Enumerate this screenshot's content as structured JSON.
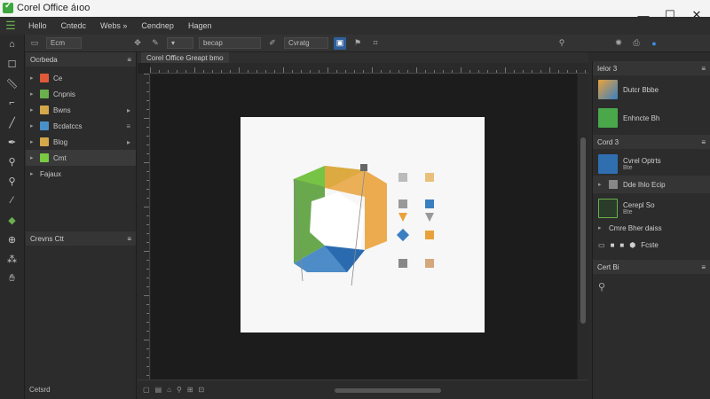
{
  "window": {
    "title": "Corel Office áıoo",
    "minimize_icon": "minimize-icon",
    "maximize_icon": "maximize-icon",
    "close_icon": "close-icon"
  },
  "menubar": {
    "items": [
      "Hello",
      "Cntedc",
      "Webs »",
      "Cendnep",
      "Hagen"
    ]
  },
  "toolbar": {
    "field1": "Ecm",
    "field2": "becap",
    "field3": "Cvratg"
  },
  "layers_panel": {
    "title": "Ocrbeda",
    "items": [
      {
        "label": "Ce",
        "color": "#e05a3a"
      },
      {
        "label": "Cnpnis",
        "color": "#6ab04c"
      },
      {
        "label": "Bwns",
        "color": "#d4a84a"
      },
      {
        "label": "Bcdatccs",
        "color": "#4a90c8"
      },
      {
        "label": "Blog",
        "color": "#d4a84a"
      },
      {
        "label": "Cmt",
        "color": "#7ac943"
      },
      {
        "label": "Fajaux",
        "color": "#888888"
      }
    ]
  },
  "lower_left_panel": {
    "title": "Crevns Ctt",
    "footer": "Cetsrd"
  },
  "document": {
    "tab_label": "Corel Office Greapt bmo"
  },
  "right_panel_top": {
    "title": "Ielor 3",
    "items": [
      {
        "label": "Dutcr Bbbe"
      },
      {
        "label": "Enhncte Bh"
      }
    ]
  },
  "right_panel_mid": {
    "title": "Cord 3",
    "item1_line1": "Cvrel Optrts",
    "item1_line2": "Bte",
    "row_label": "Dde Ihlo Ecip",
    "item2_line1": "Cerepl So",
    "item2_line2": "Bte",
    "row2_label": "Cmre Bher daiss",
    "row3_label": "Fcste"
  },
  "right_panel_bottom": {
    "title": "Cert Bi"
  },
  "colors": {
    "accent": "#2f5f9a",
    "green": "#6ab04c",
    "cube_green": "#5a9e3a",
    "cube_blue": "#3a7fc1",
    "cube_orange": "#e9a23b"
  }
}
